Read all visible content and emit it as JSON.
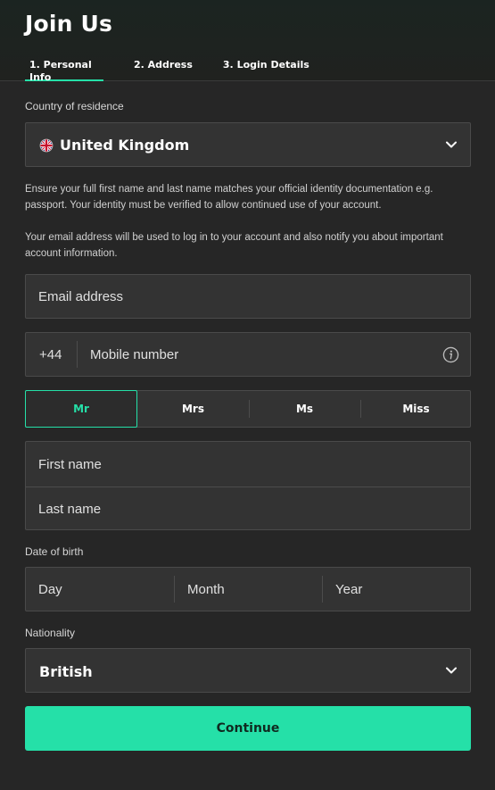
{
  "header": {
    "title": "Join Us",
    "tabs": [
      {
        "label": "1. Personal Info"
      },
      {
        "label": "2. Address"
      },
      {
        "label": "3. Login Details"
      }
    ]
  },
  "form": {
    "country_label": "Country of residence",
    "country_value": "United Kingdom",
    "country_flag_icon": "uk-flag-icon",
    "identity_note": "Ensure your full first name and last name matches your official identity documentation e.g. passport. Your identity must be verified to allow continued use of your account.",
    "email_note": "Your email address will be used to log in to your account and also notify you about important account information.",
    "email_placeholder": "Email address",
    "mobile_prefix": "+44",
    "mobile_placeholder": "Mobile number",
    "titles": [
      "Mr",
      "Mrs",
      "Ms",
      "Miss"
    ],
    "selected_title": "Mr",
    "first_name_placeholder": "First name",
    "last_name_placeholder": "Last name",
    "dob_label": "Date of birth",
    "dob": {
      "day": "Day",
      "month": "Month",
      "year": "Year"
    },
    "nationality_label": "Nationality",
    "nationality_value": "British",
    "continue_label": "Continue"
  },
  "colors": {
    "accent": "#25e0a8",
    "background": "#262626",
    "field": "#333333"
  }
}
